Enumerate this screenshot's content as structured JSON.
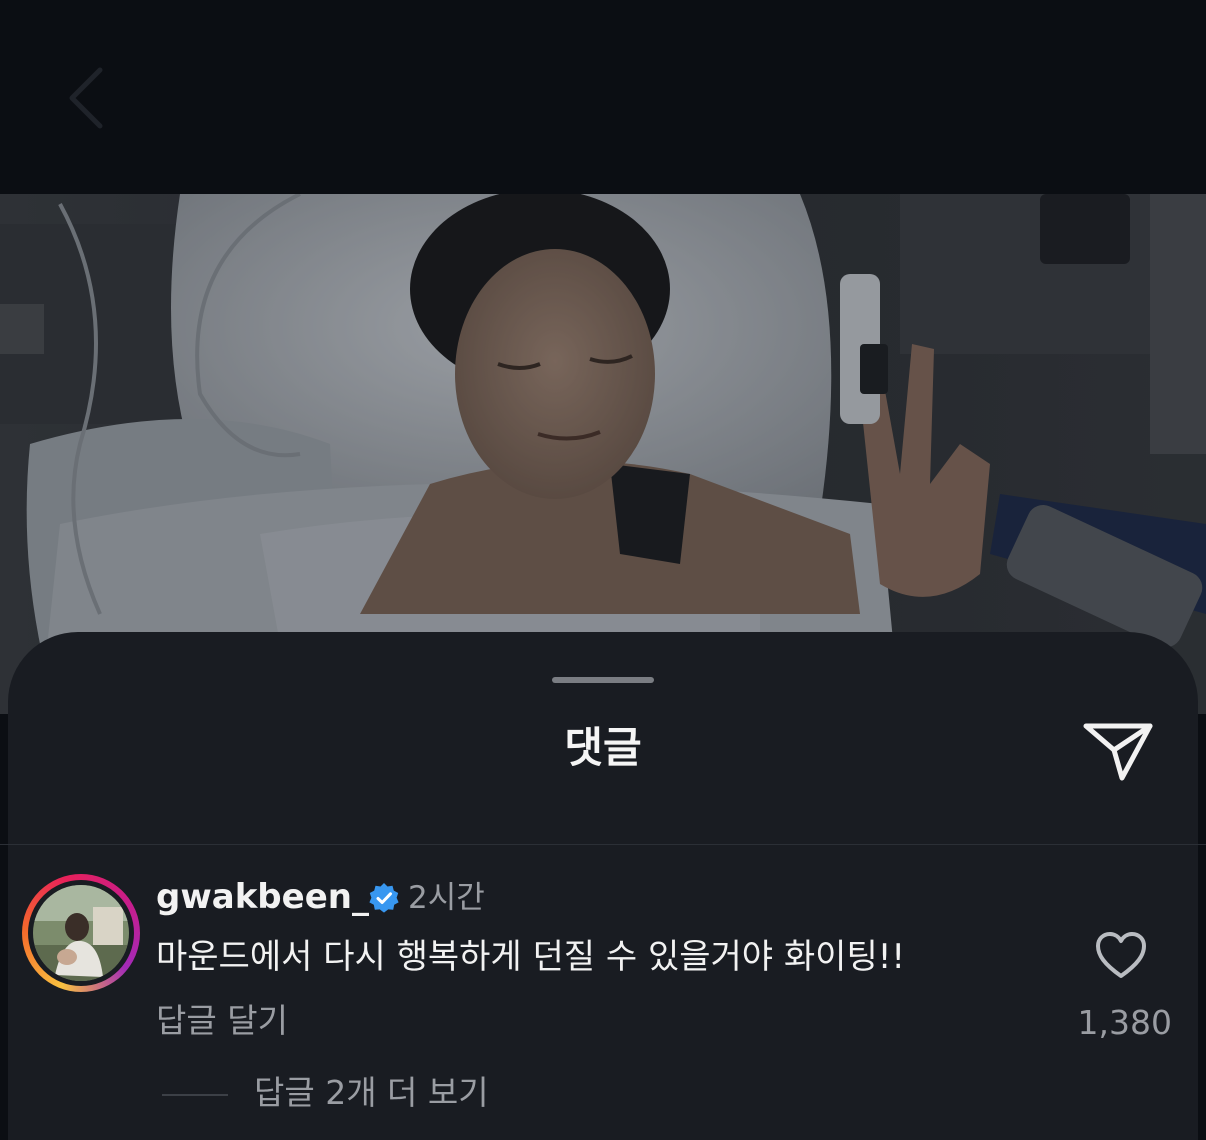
{
  "header": {
    "back_icon": "chevron-left-icon"
  },
  "post": {
    "photo_description_icon": "post-photo"
  },
  "comments_sheet": {
    "title": "댓글",
    "share_icon": "paper-plane-icon"
  },
  "comment": {
    "username": "gwakbeen_",
    "verified_icon": "verified-badge-icon",
    "timestamp": "2시간",
    "text": "마운드에서 다시 행복하게 던질 수 있을거야 화이팅!!",
    "reply_label": "답글 달기",
    "like_icon": "heart-outline-icon",
    "like_count": "1,380",
    "view_replies_label": "답글 2개 더 보기"
  },
  "colors": {
    "background": "#0b0e13",
    "sheet": "#191c22",
    "primary_text": "#f2f2f2",
    "secondary_text": "#9a9da3",
    "verified_blue": "#3897f0"
  }
}
